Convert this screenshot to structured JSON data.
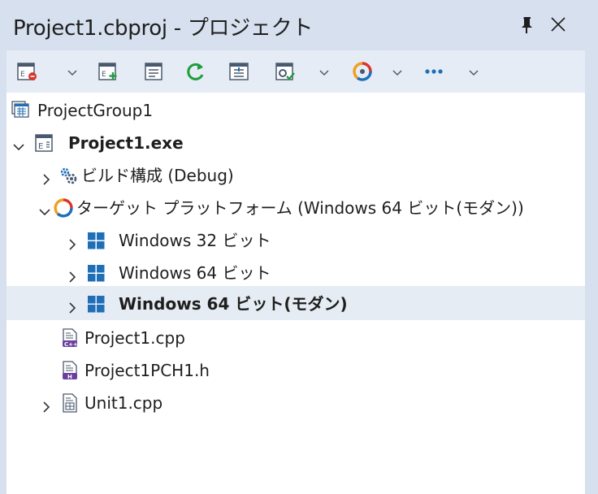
{
  "title": "Project1.cbproj - プロジェクト",
  "toolbar": {
    "buttons": [
      {
        "icon": "project-options-icon"
      },
      {
        "icon": "add-new-icon"
      },
      {
        "icon": "project-view-icon"
      },
      {
        "icon": "refresh-icon"
      },
      {
        "icon": "sync-view-icon"
      },
      {
        "icon": "build-config-icon"
      },
      {
        "icon": "platform-icon"
      },
      {
        "icon": "more-icon"
      }
    ]
  },
  "tree": {
    "items": [
      {
        "label": "ProjectGroup1",
        "icon": "project-group-icon"
      },
      {
        "label": "Project1.exe",
        "icon": "exe-project-icon"
      },
      {
        "label": "ビルド構成 (Debug)",
        "icon": "build-configurations-icon"
      },
      {
        "label": "ターゲット プラットフォーム (Windows 64 ビット(モダン))",
        "icon": "target-platforms-icon"
      },
      {
        "label": "Windows 32 ビット",
        "icon": "windows-logo-icon"
      },
      {
        "label": "Windows 64 ビット",
        "icon": "windows-logo-icon"
      },
      {
        "label": "Windows 64 ビット(モダン)",
        "icon": "windows-logo-icon",
        "selected": true
      },
      {
        "label": "Project1.cpp",
        "icon": "cpp-file-icon"
      },
      {
        "label": "Project1PCH1.h",
        "icon": "header-file-icon"
      },
      {
        "label": "Unit1.cpp",
        "icon": "unit-file-icon"
      }
    ]
  },
  "colors": {
    "chrome": "#d6e0ee",
    "toolbar": "#e6ecf5",
    "tree_background": "#ffffff",
    "selection": "#e6ecf3",
    "windows_blue": "#1f6fb8",
    "refresh_green": "#1e9e3c"
  }
}
